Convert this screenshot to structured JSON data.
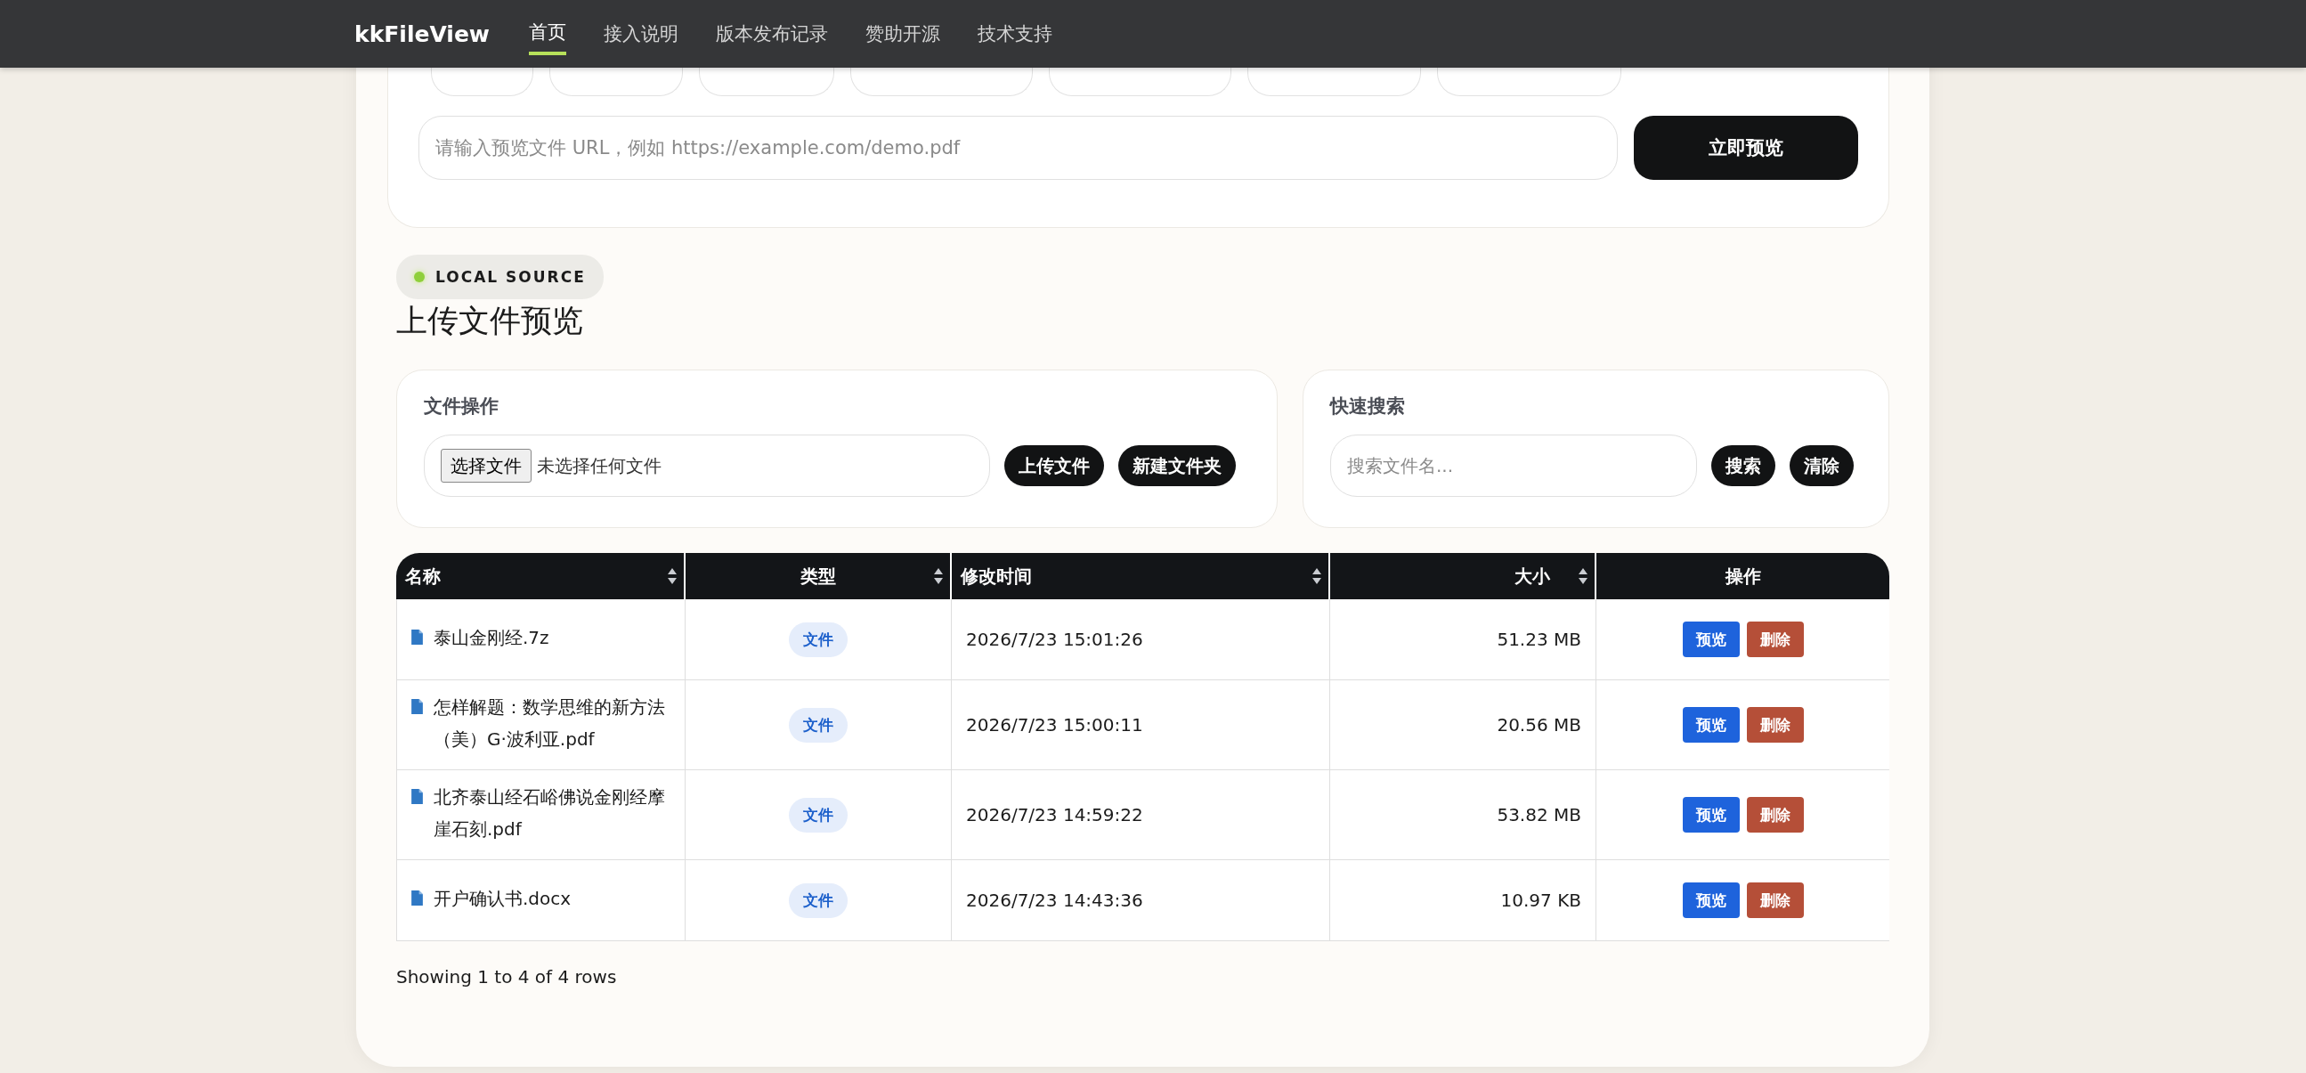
{
  "nav": {
    "brand": "kkFileView",
    "items": [
      {
        "label": "首页",
        "selected": true
      },
      {
        "label": "接入说明",
        "selected": false
      },
      {
        "label": "版本发布记录",
        "selected": false
      },
      {
        "label": "赞助开源",
        "selected": false
      },
      {
        "label": "技术支持",
        "selected": false
      }
    ]
  },
  "url_form": {
    "placeholder": "请输入预览文件 URL，例如 https://example.com/demo.pdf",
    "button": "立即预览"
  },
  "section": {
    "badge": "LOCAL SOURCE",
    "title": "上传文件预览"
  },
  "file_ops": {
    "title": "文件操作",
    "choose_button": "选择文件",
    "no_file": "未选择任何文件",
    "buttons": [
      "上传文件",
      "新建文件夹"
    ]
  },
  "search": {
    "title": "快速搜索",
    "placeholder": "搜索文件名...",
    "buttons": [
      "搜索",
      "清除"
    ]
  },
  "table": {
    "columns": [
      {
        "label": "名称",
        "sortable": true
      },
      {
        "label": "类型",
        "sortable": true
      },
      {
        "label": "修改时间",
        "sortable": true
      },
      {
        "label": "大小",
        "sortable": true
      },
      {
        "label": "操作",
        "sortable": false
      }
    ],
    "rows": [
      {
        "name": "泰山金刚经.7z",
        "type": "文件",
        "modified": "2026/7/23 15:01:26",
        "size": "51.23 MB",
        "actions": [
          "预览",
          "删除"
        ]
      },
      {
        "name": "怎样解题：数学思维的新方法（美）G·波利亚.pdf",
        "type": "文件",
        "modified": "2026/7/23 15:00:11",
        "size": "20.56 MB",
        "actions": [
          "预览",
          "删除"
        ]
      },
      {
        "name": "北齐泰山经石峪佛说金刚经摩崖石刻.pdf",
        "type": "文件",
        "modified": "2026/7/23 14:59:22",
        "size": "53.82 MB",
        "actions": [
          "预览",
          "删除"
        ]
      },
      {
        "name": "开户确认书.docx",
        "type": "文件",
        "modified": "2026/7/23 14:43:36",
        "size": "10.97 KB",
        "actions": [
          "预览",
          "删除"
        ]
      }
    ]
  },
  "footer": "Showing 1 to 4 of 4 rows"
}
